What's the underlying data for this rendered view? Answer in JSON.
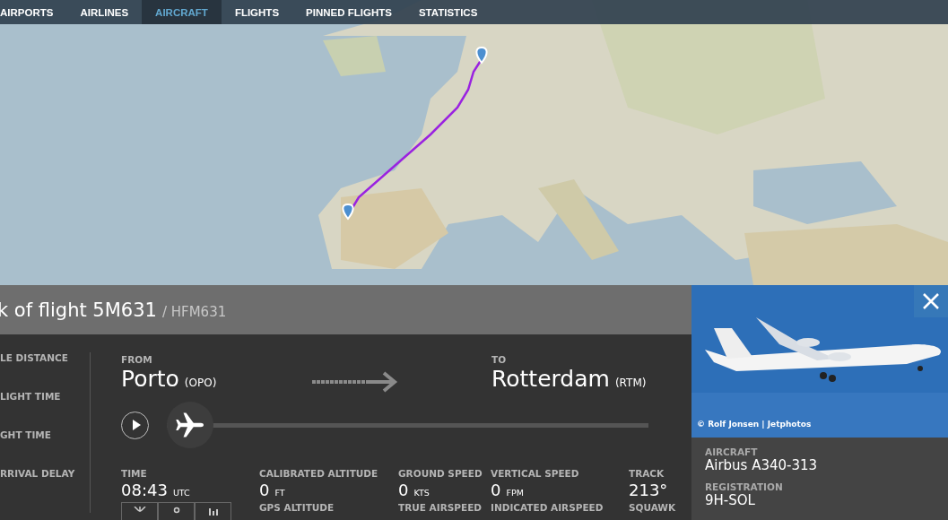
{
  "nav": {
    "tabs": [
      {
        "label": "AIRPORTS",
        "selected": false
      },
      {
        "label": "AIRLINES",
        "selected": false
      },
      {
        "label": "AIRCRAFT",
        "selected": true
      },
      {
        "label": "FLIGHTS",
        "selected": false
      },
      {
        "label": "PINNED FLIGHTS",
        "selected": false
      },
      {
        "label": "STATISTICS",
        "selected": false
      }
    ]
  },
  "flight_header": {
    "title": "k of flight 5M631",
    "callsign": "/ HFM631"
  },
  "side_labels": [
    "LE DISTANCE",
    "LIGHT TIME",
    "GHT TIME",
    "RRIVAL DELAY"
  ],
  "route": {
    "from": {
      "label": "FROM",
      "city": "Porto",
      "code": "(OPO)"
    },
    "to": {
      "label": "TO",
      "city": "Rotterdam",
      "code": "(RTM)"
    }
  },
  "playback": {
    "level": 0
  },
  "stats": [
    {
      "label": "TIME",
      "value": "08:43",
      "unit": "UTC"
    },
    {
      "label": "CALIBRATED ALTITUDE",
      "value": "0",
      "unit": "FT",
      "sublabel": "GPS ALTITUDE"
    },
    {
      "label": "GROUND SPEED",
      "value": "0",
      "unit": "KTS",
      "sublabel": "TRUE AIRSPEED"
    },
    {
      "label": "VERTICAL SPEED",
      "value": "0",
      "unit": "FPM",
      "sublabel": "INDICATED AIRSPEED"
    },
    {
      "label": "TRACK",
      "value": "213°",
      "sublabel": "SQUAWK"
    }
  ],
  "aircraft": {
    "credit": "© Rolf Jonsen | Jetphotos",
    "fields": [
      {
        "label": "AIRCRAFT",
        "value": "Airbus A340-313"
      },
      {
        "label": "REGISTRATION",
        "value": "9H-SOL"
      }
    ]
  }
}
